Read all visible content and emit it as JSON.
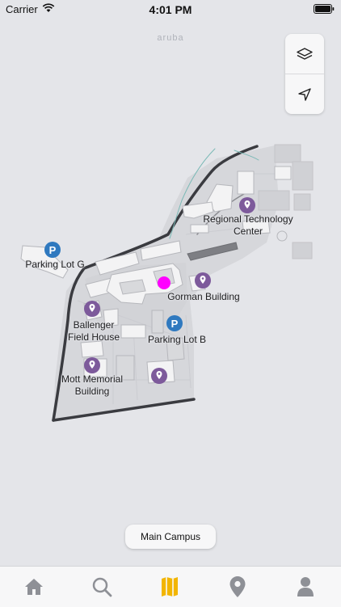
{
  "status_bar": {
    "carrier": "Carrier",
    "time": "4:01 PM"
  },
  "map": {
    "watermark": "aruba",
    "accent_color": "#7d5a9b",
    "parking_color": "#2f79bf",
    "current_location_color": "#ff00ff",
    "labels": {
      "regional_line1": "Regional Technology",
      "regional_line2": "Center",
      "parking_g": "Parking Lot G",
      "gorman": "Gorman Building",
      "ballenger_line1": "Ballenger",
      "ballenger_line2": "Field House",
      "parking_b": "Parking Lot B",
      "mott_line1": "Mott Memorial",
      "mott_line2": "Building"
    },
    "controls": {
      "layers_icon": "layers-icon",
      "locate_icon": "location-arrow-icon"
    }
  },
  "campus_button": {
    "label": "Main Campus"
  },
  "tab_bar": {
    "active_color": "#f2b500",
    "inactive_color": "#8e9096",
    "items": [
      {
        "name": "home",
        "icon": "home-icon"
      },
      {
        "name": "search",
        "icon": "search-icon"
      },
      {
        "name": "map",
        "icon": "map-icon",
        "active": true
      },
      {
        "name": "places",
        "icon": "map-pin-icon"
      },
      {
        "name": "profile",
        "icon": "person-icon"
      }
    ]
  }
}
